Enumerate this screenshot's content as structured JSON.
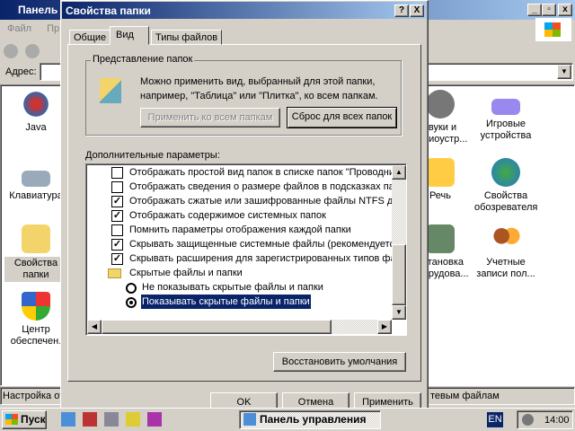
{
  "bg_window": {
    "title": "Панель",
    "menu": [
      "Файл",
      "Пр"
    ],
    "address_label": "Адрес:",
    "status": "Настройка от",
    "status_right": "тевым файлам",
    "icons_left": [
      "Java",
      "Клавиатура",
      "Свойства папки",
      "Центр обеспечен."
    ],
    "icons_right": [
      [
        "звуки и",
        "аудиоустр..."
      ],
      [
        "Игровые",
        "устройства"
      ],
      [
        "Речь",
        ""
      ],
      [
        "Свойства",
        "обозревателя"
      ],
      [
        "Установка",
        "оборудова..."
      ],
      [
        "Учетные",
        "записи пол..."
      ]
    ]
  },
  "dialog": {
    "title": "Свойства папки",
    "help": "?",
    "close": "X",
    "tabs": [
      "Общие",
      "Вид",
      "Типы файлов"
    ],
    "active_tab": 1,
    "group_title": "Представление папок",
    "group_text": [
      "Можно применить вид, выбранный для этой папки,",
      "например, \"Таблица\" или \"Плитка\", ко всем папкам."
    ],
    "apply_all": "Применить ко всем папкам",
    "reset_all": "Сброс для всех папок",
    "advanced_label": "Дополнительные параметры:",
    "options": [
      {
        "label": "Отображать простой вид папок в списке папок \"Проводника\"",
        "checked": false
      },
      {
        "label": "Отображать сведения о размере файлов в подсказках папок",
        "checked": false
      },
      {
        "label": "Отображать сжатые или зашифрованные файлы NTFS другим цветом",
        "checked": true
      },
      {
        "label": "Отображать содержимое системных папок",
        "checked": true
      },
      {
        "label": "Помнить параметры отображения каждой папки",
        "checked": false
      },
      {
        "label": "Скрывать защищенные системные файлы (рекомендуется)",
        "checked": true
      },
      {
        "label": "Скрывать расширения для зарегистрированных типов файлов",
        "checked": true
      }
    ],
    "folder_item": "Скрытые файлы и папки",
    "radios": [
      {
        "label": "Не показывать скрытые файлы и папки",
        "selected": false
      },
      {
        "label": "Показывать скрытые файлы и папки",
        "selected": true
      }
    ],
    "restore": "Восстановить умолчания",
    "ok": "OK",
    "cancel": "Отмена",
    "apply": "Применить"
  },
  "taskbar": {
    "start": "Пуск",
    "task": "Панель управления",
    "lang": "EN",
    "time": "14:00"
  },
  "colors": {
    "title": "#0a246a",
    "selection": "#0a246a",
    "face": "#d4d0c8"
  }
}
